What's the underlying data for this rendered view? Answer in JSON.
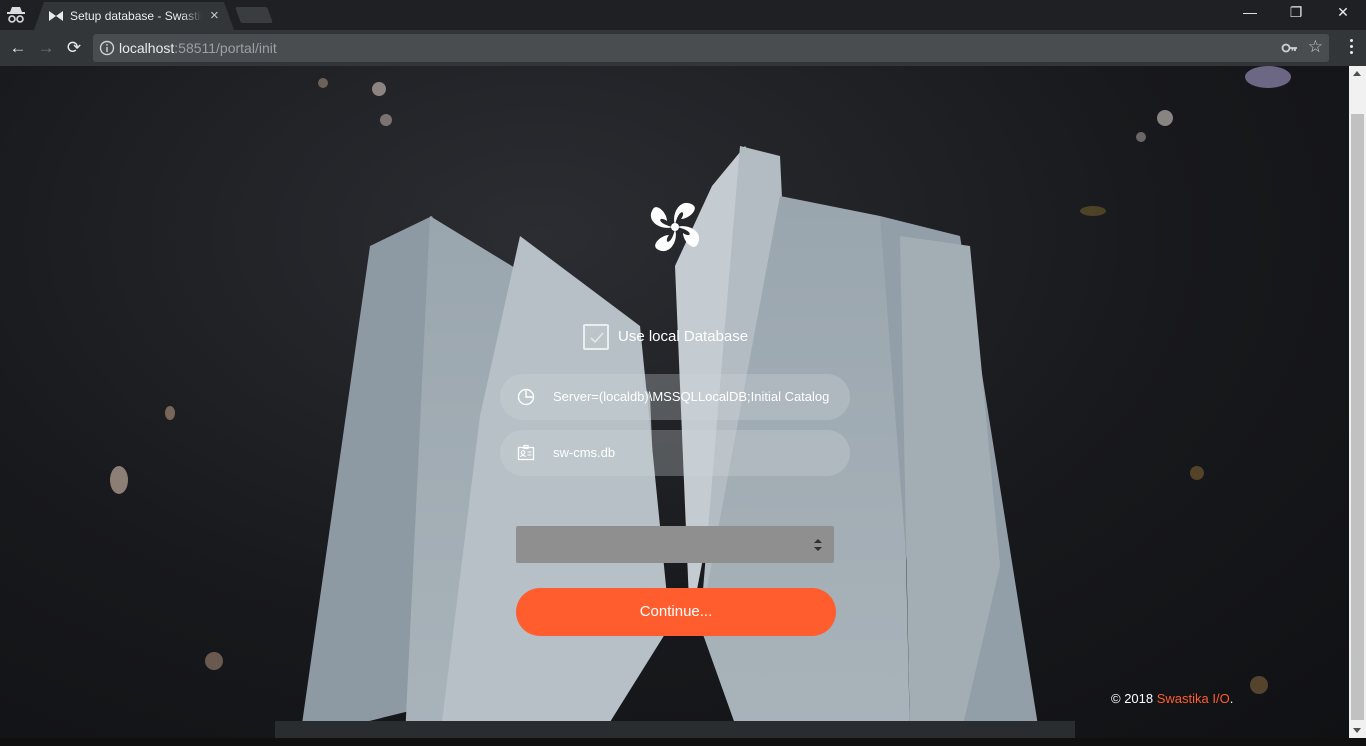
{
  "browser": {
    "tab_title": "Setup database - Swastika",
    "tab_close": "×",
    "url_host": "localhost",
    "url_rest": ":58511/portal/init",
    "window_minimize": "—",
    "window_restore": "❐",
    "window_close": "✕",
    "back": "←",
    "forward": "→",
    "reload": "⟳",
    "star": "☆"
  },
  "page": {
    "use_local_label": "Use local Database",
    "use_local_checked": true,
    "connection_string": "Server=(localdb)\\MSSQLLocalDB;Initial Catalog",
    "database_file": "sw-cms.db",
    "provider_select_value": "",
    "continue_label": "Continue...",
    "footer_copyright": "© 2018 ",
    "footer_brand": "Swastika I/O",
    "footer_dot": "."
  },
  "colors": {
    "accent": "#ff5d2e",
    "chrome_dark": "#202124",
    "toolbar": "#323639"
  },
  "icons": [
    "incognito-icon",
    "favicon-icon",
    "info-icon",
    "key-icon",
    "star-icon",
    "menu-icon",
    "logo-icon",
    "check-icon",
    "pie-chart-icon",
    "id-card-icon",
    "select-arrows-icon"
  ]
}
